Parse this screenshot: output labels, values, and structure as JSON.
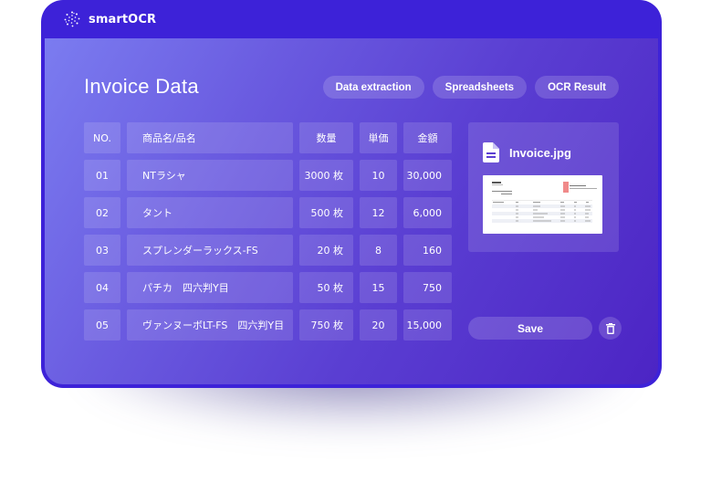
{
  "app": {
    "name": "smartOCR",
    "logo_icon": "sparkle-dots-icon"
  },
  "page": {
    "title": "Invoice Data"
  },
  "tabs": [
    {
      "label": "Data extraction"
    },
    {
      "label": "Spreadsheets"
    },
    {
      "label": "OCR Result"
    }
  ],
  "table": {
    "headers": {
      "no": "NO.",
      "name": "商品名/品名",
      "qty": "数量",
      "price": "単価",
      "amount": "金額"
    },
    "rows": [
      {
        "no": "01",
        "name": "NTラシャ",
        "qty": "3000 枚",
        "price": "10",
        "amount": "30,000"
      },
      {
        "no": "02",
        "name": "タント",
        "qty": "500  枚",
        "price": "12",
        "amount": "6,000"
      },
      {
        "no": "03",
        "name": "スプレンダーラックス-FS",
        "qty": "20  枚",
        "price": "8",
        "amount": "160"
      },
      {
        "no": "04",
        "name": "パチカ　四六判Y目",
        "qty": "50  枚",
        "price": "15",
        "amount": "750"
      },
      {
        "no": "05",
        "name": "ヴァンヌーボLT-FS　四六判Y目",
        "qty": "750  枚",
        "price": "20",
        "amount": "15,000"
      }
    ]
  },
  "preview": {
    "file_name": "Invoice.jpg",
    "file_icon": "document-icon"
  },
  "actions": {
    "save_label": "Save",
    "delete_icon": "trash-icon"
  },
  "colors": {
    "frame": "#3D22D8",
    "gradient_start": "#7B7CF0",
    "gradient_end": "#4C24C4",
    "text": "#FFFFFF"
  }
}
